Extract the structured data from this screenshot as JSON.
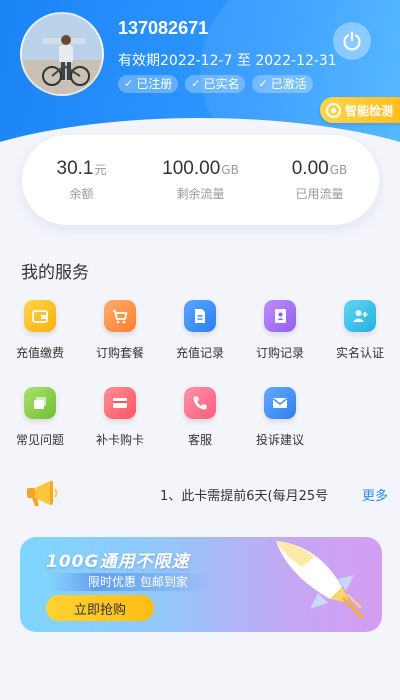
{
  "account": {
    "phone": "137082671",
    "validity": "有效期2022-12-7 至 2022-12-31",
    "badges": [
      "已注册",
      "已实名",
      "已激活"
    ]
  },
  "smart_check_label": "智能检测",
  "stats": [
    {
      "value": "30.1",
      "unit": "元",
      "label": "余额"
    },
    {
      "value": "100.00",
      "unit": "GB",
      "label": "剩余流量"
    },
    {
      "value": "0.00",
      "unit": "GB",
      "label": "已用流量"
    }
  ],
  "services_title": "我的服务",
  "services": [
    {
      "label": "充值缴费",
      "icon": "wallet-icon",
      "color": "#fbbf1c"
    },
    {
      "label": "订购套餐",
      "icon": "cart-icon",
      "color": "#ff9547"
    },
    {
      "label": "充值记录",
      "icon": "document-icon",
      "color": "#3a8ff6"
    },
    {
      "label": "订购记录",
      "icon": "contact-book-icon",
      "color": "#a774f0"
    },
    {
      "label": "实名认证",
      "icon": "add-user-icon",
      "color": "#36bde8"
    },
    {
      "label": "常见问题",
      "icon": "layers-icon",
      "color": "#8fd14e"
    },
    {
      "label": "补卡购卡",
      "icon": "card-icon",
      "color": "#ff6a73"
    },
    {
      "label": "客服",
      "icon": "phone-icon",
      "color": "#ff6f8e"
    },
    {
      "label": "投诉建议",
      "icon": "mail-icon",
      "color": "#3f8ff5"
    }
  ],
  "notice": {
    "text": "1、此卡需提前6天(每月25号",
    "more": "更多"
  },
  "banner": {
    "title": "100G通用不限速",
    "subtitle": "限时优惠 包邮到家",
    "button": "立即抢购"
  }
}
